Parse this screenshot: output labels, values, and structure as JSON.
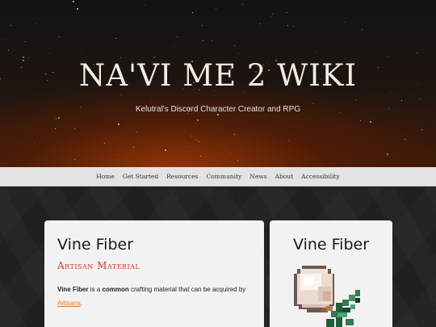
{
  "hero": {
    "title": "NA'VI ME 2 WIKI",
    "tagline": "Kelutral's Discord Character Creator and RPG"
  },
  "nav": {
    "items": [
      {
        "label": "Home"
      },
      {
        "label": "Get Started"
      },
      {
        "label": "Resources"
      },
      {
        "label": "Community"
      },
      {
        "label": "News"
      },
      {
        "label": "About"
      },
      {
        "label": "Accessibility"
      }
    ]
  },
  "article": {
    "title": "Vine Fiber",
    "category": "Artisan Material",
    "desc": {
      "item_name": "Vine Fiber",
      "part1": " is a ",
      "rarity": "common",
      "part2": " crafting material that can be acquired by ",
      "link": "Artisans",
      "part3": "."
    }
  },
  "infobox": {
    "title": "Vine Fiber",
    "image_icon": "vine-fiber-sprite-icon"
  },
  "colors": {
    "accent_red": "#d8342e",
    "link_orange": "#e07a28",
    "navbar_bg": "#e3e3e3"
  }
}
